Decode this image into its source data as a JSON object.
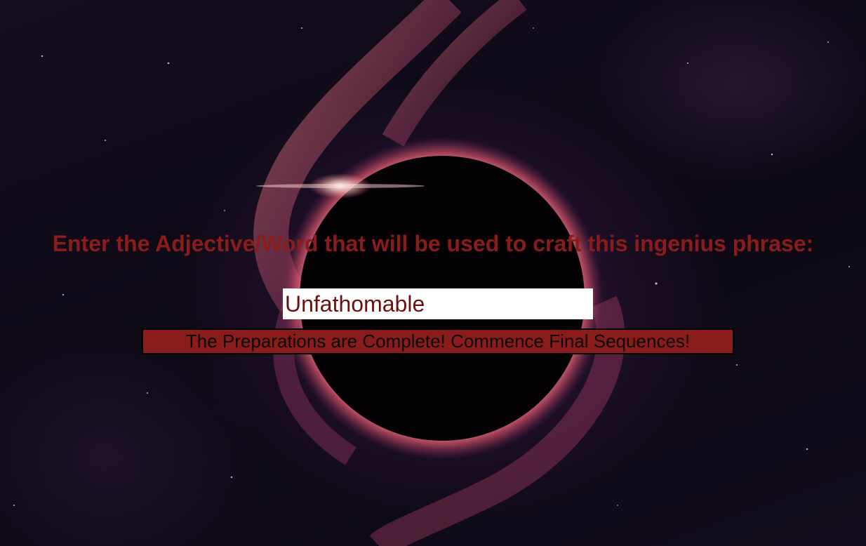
{
  "page": {
    "prompt": "Enter the Adjective/Word that will be used to craft this ingenius phrase:",
    "input_value": "Unfathomable",
    "button_label": "The Preparations are Complete! Commence Final Sequences!"
  },
  "colors": {
    "accent": "#8b1c1c",
    "input_background": "#ffffff",
    "input_text": "#6a1010",
    "button_text": "#0a0a0a"
  },
  "background": {
    "description_icon": "black-hole-nebula"
  }
}
